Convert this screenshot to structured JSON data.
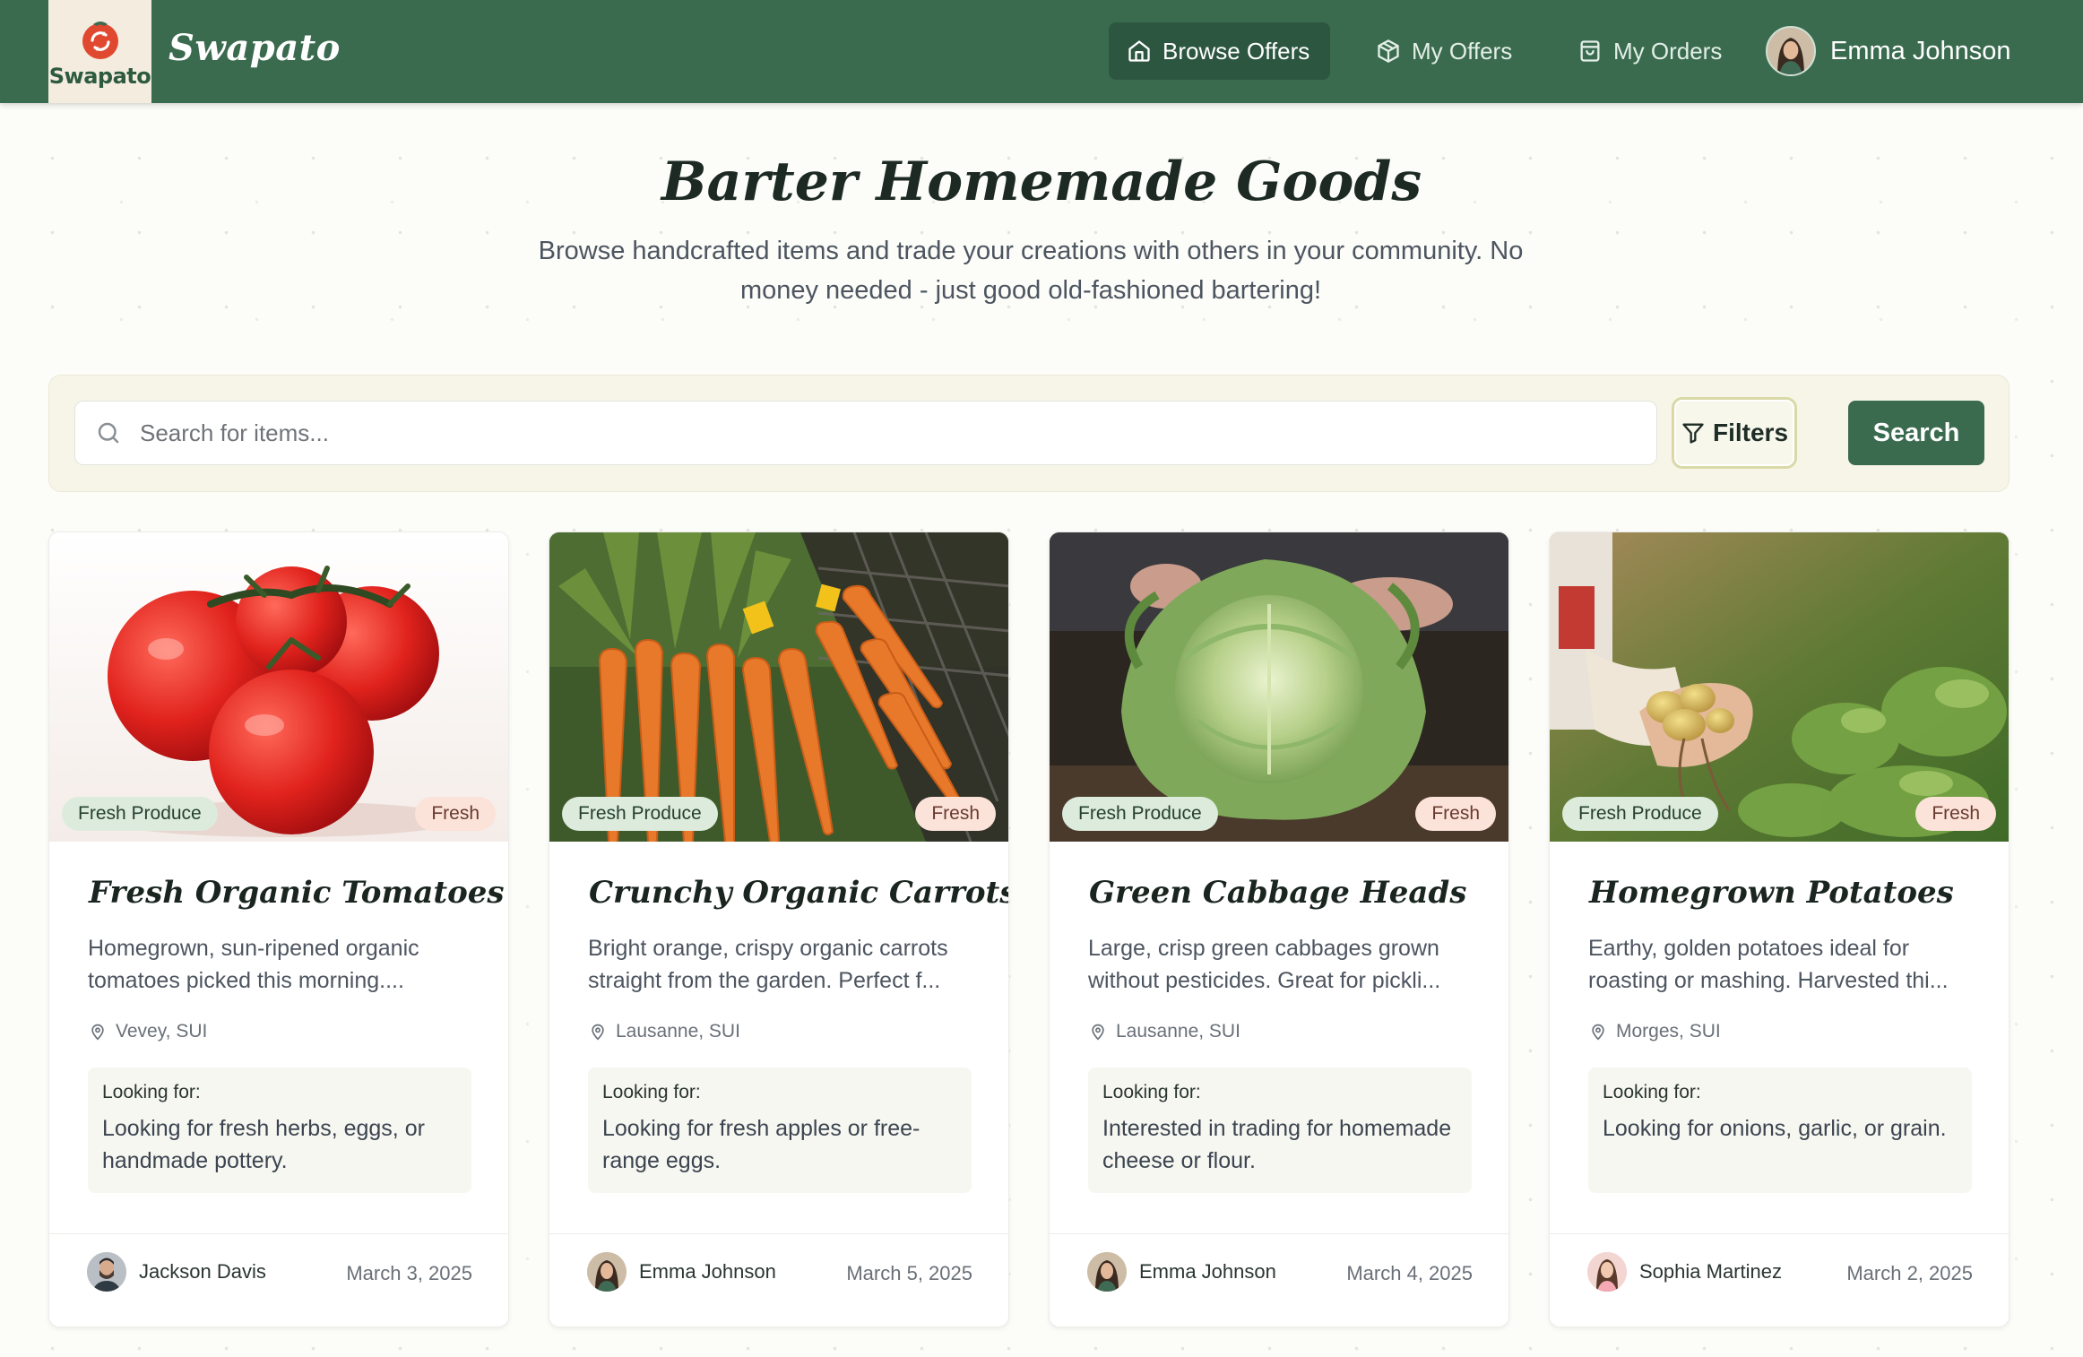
{
  "app": {
    "logo_text": "Swapato",
    "brand_name": "Swapato"
  },
  "nav": {
    "browse_offers": "Browse Offers",
    "my_offers": "My Offers",
    "my_orders": "My Orders",
    "user_name": "Emma Johnson"
  },
  "hero": {
    "title": "Barter Homemade Goods",
    "subtitle": "Browse handcrafted items and trade your creations with others in your community. No money needed - just good old-fashioned bartering!"
  },
  "search": {
    "placeholder": "Search for items...",
    "filters_label": "Filters",
    "search_label": "Search"
  },
  "colors": {
    "brand_green": "#3a6b4f",
    "category_badge": "#dcebdc",
    "condition_badge": "#fbe3d9"
  },
  "listings": [
    {
      "category": "Fresh Produce",
      "condition": "Fresh",
      "title": "Fresh Organic Tomatoes",
      "description": "Homegrown, sun-ripened organic tomatoes picked this morning....",
      "location": "Vevey, SUI",
      "looking_label": "Looking for:",
      "looking_for": "Looking for fresh herbs, eggs, or handmade pottery.",
      "owner": "Jackson Davis",
      "date": "March 3, 2025"
    },
    {
      "category": "Fresh Produce",
      "condition": "Fresh",
      "title": "Crunchy Organic Carrots",
      "description": "Bright orange, crispy organic carrots straight from the garden. Perfect f...",
      "location": "Lausanne, SUI",
      "looking_label": "Looking for:",
      "looking_for": "Looking for fresh apples or free-range eggs.",
      "owner": "Emma Johnson",
      "date": "March 5, 2025"
    },
    {
      "category": "Fresh Produce",
      "condition": "Fresh",
      "title": "Green Cabbage Heads",
      "description": "Large, crisp green cabbages grown without pesticides. Great for pickli...",
      "location": "Lausanne, SUI",
      "looking_label": "Looking for:",
      "looking_for": "Interested in trading for homemade cheese or flour.",
      "owner": "Emma Johnson",
      "date": "March 4, 2025"
    },
    {
      "category": "Fresh Produce",
      "condition": "Fresh",
      "title": "Homegrown Potatoes",
      "description": "Earthy, golden potatoes ideal for roasting or mashing. Harvested thi...",
      "location": "Morges, SUI",
      "looking_label": "Looking for:",
      "looking_for": "Looking for onions, garlic, or grain.",
      "owner": "Sophia Martinez",
      "date": "March 2, 2025"
    }
  ]
}
